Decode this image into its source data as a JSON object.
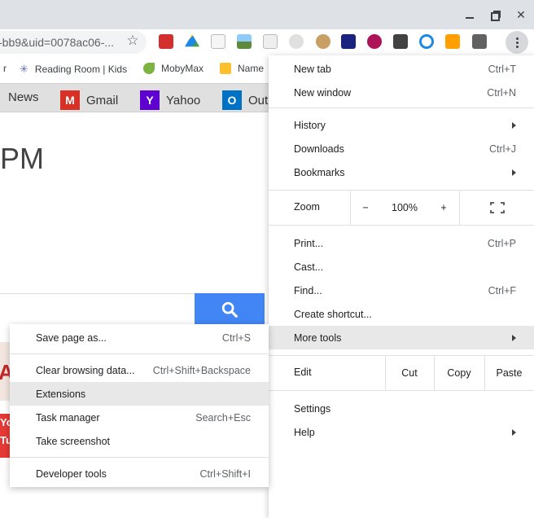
{
  "window": {
    "minimize_icon": "minimize-icon",
    "restore_icon": "restore-icon",
    "close_glyph": "✕"
  },
  "omnibox": {
    "url_text": "-bb9&uid=0078ac06-..."
  },
  "bookmarks_bar": [
    {
      "label": "r",
      "icon": "unknown-favicon"
    },
    {
      "label": "Reading Room | Kids",
      "icon": "reading-room-icon"
    },
    {
      "label": "MobyMax",
      "icon": "mobymax-icon"
    },
    {
      "label": "Name",
      "icon": "name-icon"
    }
  ],
  "page": {
    "nav": [
      {
        "label": "News",
        "icon": "news-icon"
      },
      {
        "label": "Gmail",
        "icon": "gmail-icon"
      },
      {
        "label": "Yahoo",
        "icon": "yahoo-icon"
      },
      {
        "label": "Out",
        "icon": "outlook-icon"
      }
    ],
    "clock_text": "PM",
    "thumb2_text": "You\nTub"
  },
  "main_menu": {
    "new_tab": {
      "label": "New tab",
      "shortcut": "Ctrl+T"
    },
    "new_window": {
      "label": "New window",
      "shortcut": "Ctrl+N"
    },
    "history": {
      "label": "History"
    },
    "downloads": {
      "label": "Downloads",
      "shortcut": "Ctrl+J"
    },
    "bookmarks": {
      "label": "Bookmarks"
    },
    "zoom": {
      "label": "Zoom",
      "minus": "−",
      "level": "100%",
      "plus": "+"
    },
    "print": {
      "label": "Print...",
      "shortcut": "Ctrl+P"
    },
    "cast": {
      "label": "Cast..."
    },
    "find": {
      "label": "Find...",
      "shortcut": "Ctrl+F"
    },
    "create_shortcut": {
      "label": "Create shortcut..."
    },
    "more_tools": {
      "label": "More tools"
    },
    "edit": {
      "label": "Edit",
      "cut": "Cut",
      "copy": "Copy",
      "paste": "Paste"
    },
    "settings": {
      "label": "Settings"
    },
    "help": {
      "label": "Help"
    }
  },
  "sub_menu": {
    "save_page": {
      "label": "Save page as...",
      "shortcut": "Ctrl+S"
    },
    "clear_browsing": {
      "label": "Clear browsing data...",
      "shortcut": "Ctrl+Shift+Backspace"
    },
    "extensions": {
      "label": "Extensions"
    },
    "task_manager": {
      "label": "Task manager",
      "shortcut": "Search+Esc"
    },
    "take_screenshot": {
      "label": "Take screenshot"
    },
    "developer_tools": {
      "label": "Developer tools",
      "shortcut": "Ctrl+Shift+I"
    }
  },
  "colors": {
    "titlebar": "#dee1e6",
    "menu_highlight": "#e8e8e8",
    "search_button": "#4285f4"
  }
}
